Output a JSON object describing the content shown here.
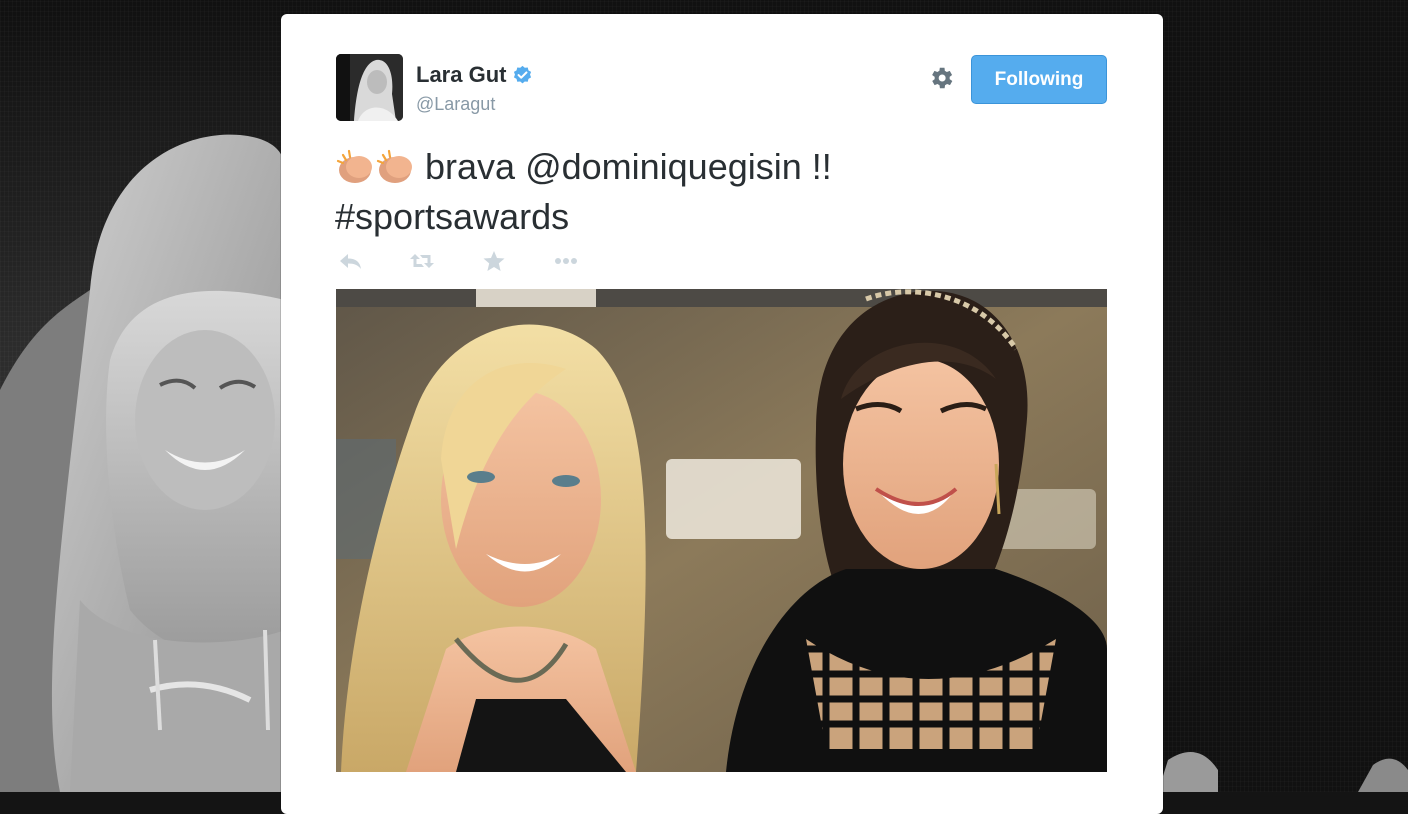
{
  "tweet": {
    "author_name": "Lara Gut",
    "author_handle": "@Laragut",
    "verified": true,
    "follow_button_label": "Following",
    "text_line1": "brava @dominiquegisin !!",
    "text_line2": "#sportsawards",
    "emoji": [
      "clapping-hands-icon",
      "clapping-hands-icon"
    ],
    "actions": [
      "reply-icon",
      "retweet-icon",
      "favorite-icon",
      "more-icon"
    ]
  },
  "colors": {
    "follow_button": "#55acee",
    "name_text": "#292f33",
    "handle_text": "#8899a6",
    "action_icon": "#ccd6dd"
  }
}
